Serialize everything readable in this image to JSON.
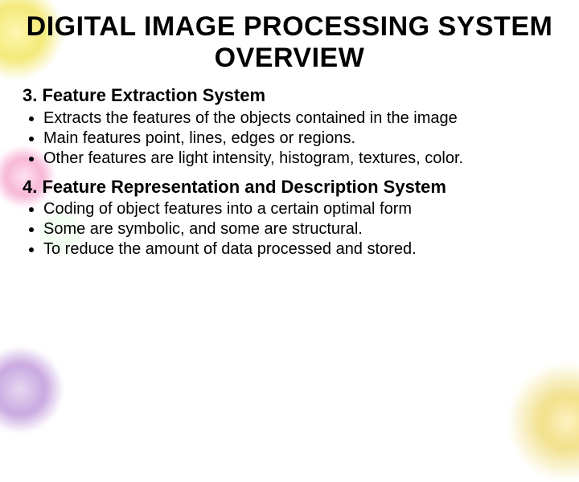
{
  "title": "DIGITAL IMAGE PROCESSING SYSTEM OVERVIEW",
  "sections": [
    {
      "heading": "3. Feature Extraction System",
      "bullets": [
        "Extracts the features of the objects contained in the image",
        "Main features point, lines, edges or regions.",
        "Other features are light intensity, histogram, textures, color."
      ]
    },
    {
      "heading": "4. Feature Representation and Description System",
      "bullets": [
        "Coding of object features into a certain optimal form",
        "Some are symbolic, and some are structural.",
        "To reduce the amount of data processed and stored."
      ]
    }
  ]
}
